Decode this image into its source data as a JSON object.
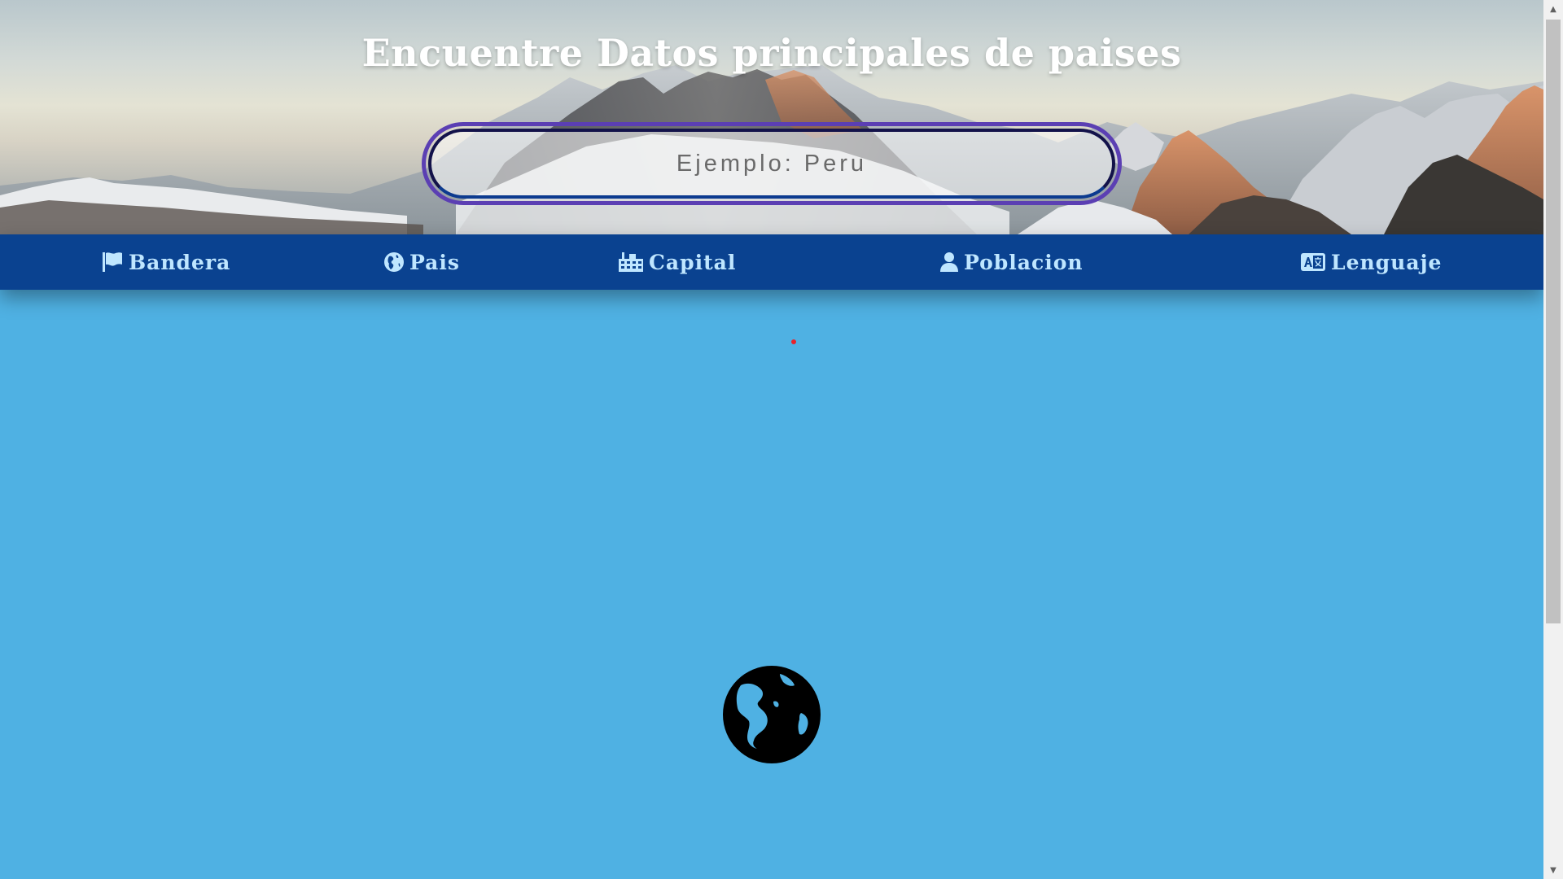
{
  "header": {
    "title": "Encuentre Datos principales de paises"
  },
  "search": {
    "placeholder": "Ejemplo: Peru",
    "value": ""
  },
  "nav": {
    "items": [
      {
        "label": "Bandera",
        "icon": "flag-icon"
      },
      {
        "label": "Pais",
        "icon": "globe-americas-icon"
      },
      {
        "label": "Capital",
        "icon": "city-icon"
      },
      {
        "label": "Poblacion",
        "icon": "user-icon"
      },
      {
        "label": "Lenguaje",
        "icon": "language-icon"
      }
    ]
  },
  "main": {
    "icon": "globe-icon"
  },
  "colors": {
    "page_background": "#4fb1e3",
    "navbar_background": "#0a4290",
    "nav_text": "#bfe6ff",
    "search_border": "#5b3fb3",
    "title_text": "#ffffff",
    "status_dot": "#e8222a"
  }
}
